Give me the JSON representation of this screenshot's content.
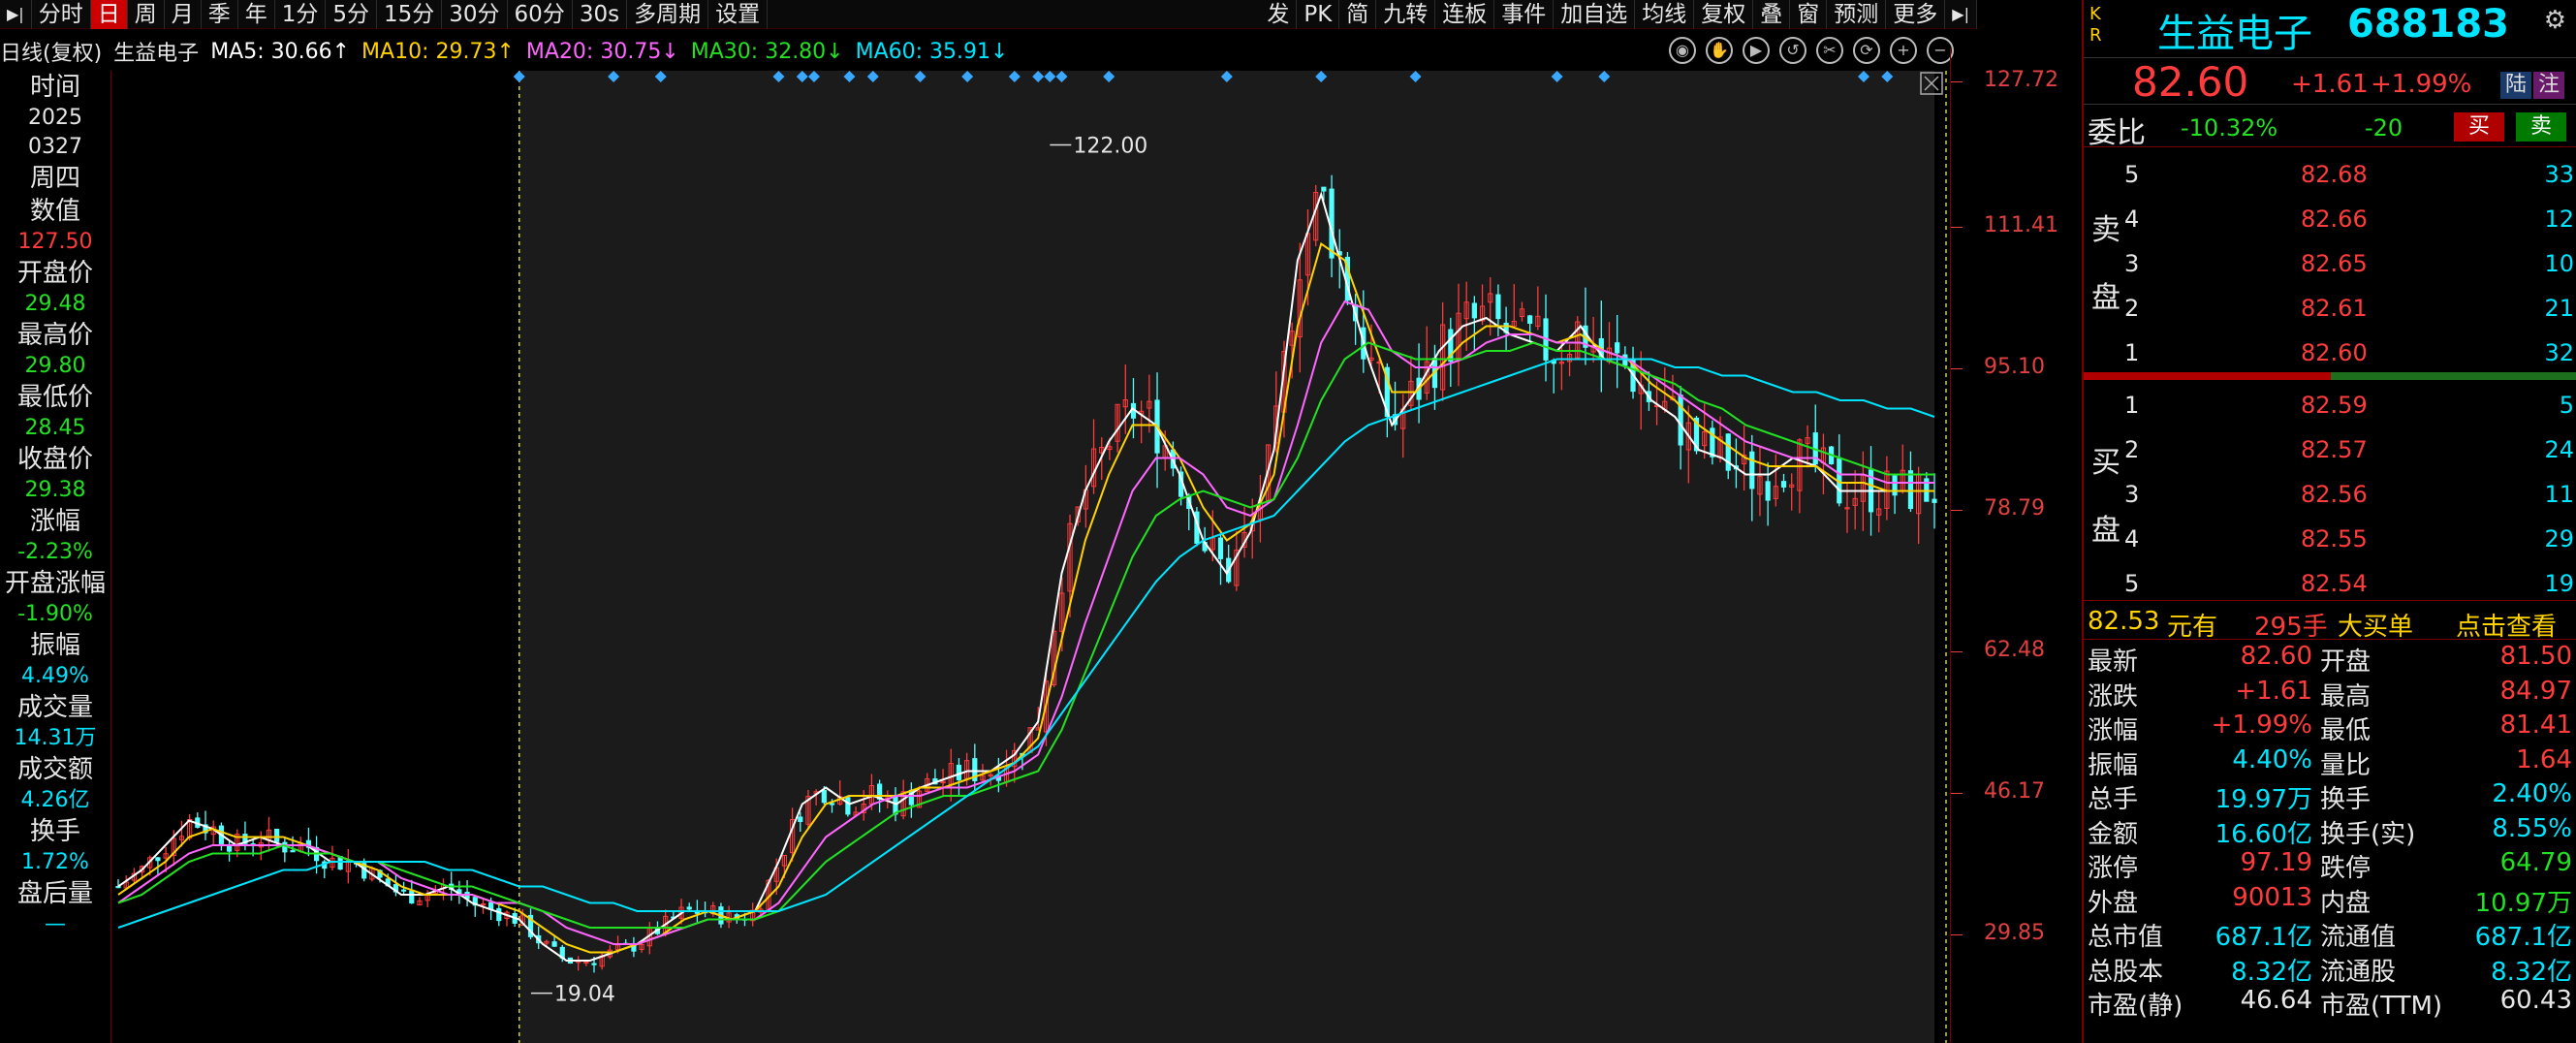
{
  "toolbar": {
    "left_items": [
      "分时",
      "日",
      "周",
      "月",
      "季",
      "年",
      "1分",
      "5分",
      "15分",
      "30分",
      "60分",
      "30s",
      "多周期",
      "设置"
    ],
    "active": "日",
    "right_items": [
      "发",
      "PK",
      "简",
      "九转",
      "连板",
      "事件",
      "加自选",
      "均线",
      "复权",
      "叠",
      "窗",
      "预测",
      "更多"
    ]
  },
  "ma_legend": {
    "prefix": "日线(复权)",
    "name": "生益电子",
    "ma5": "MA5: 30.66↑",
    "ma10": "MA10: 29.73↑",
    "ma20": "MA20: 30.75↓",
    "ma30": "MA30: 32.80↓",
    "ma60": "MA60: 35.91↓"
  },
  "colors": {
    "up": "#ff3b3b",
    "down": "#22e022",
    "ma5": "#ffffff",
    "ma10": "#ffd200",
    "ma20": "#ff66ff",
    "ma30": "#22e022",
    "ma60": "#00e5ff",
    "axis": "#e04040"
  },
  "left_panel": [
    {
      "label": "时间",
      "value": "2025",
      "color": "#e6e6e6"
    },
    {
      "label": "",
      "value": "0327",
      "color": "#e6e6e6"
    },
    {
      "label": "周四",
      "value": "",
      "color": "#e6e6e6"
    },
    {
      "label": "数值",
      "value": "127.50",
      "color": "#ff3b3b"
    },
    {
      "label": "开盘价",
      "value": "29.48",
      "color": "#22e022"
    },
    {
      "label": "最高价",
      "value": "29.80",
      "color": "#22e022"
    },
    {
      "label": "最低价",
      "value": "28.45",
      "color": "#22e022"
    },
    {
      "label": "收盘价",
      "value": "29.38",
      "color": "#22e022"
    },
    {
      "label": "涨幅",
      "value": "-2.23%",
      "color": "#22e022"
    },
    {
      "label": "开盘涨幅",
      "value": "-1.90%",
      "color": "#22e022"
    },
    {
      "label": "振幅",
      "value": "4.49%",
      "color": "#00e5ff"
    },
    {
      "label": "成交量",
      "value": "14.31万",
      "color": "#00e5ff"
    },
    {
      "label": "成交额",
      "value": "4.26亿",
      "color": "#00e5ff"
    },
    {
      "label": "换手",
      "value": "1.72%",
      "color": "#00e5ff"
    },
    {
      "label": "盘后量",
      "value": "—",
      "color": "#00e5ff"
    }
  ],
  "y_axis_ticks": [
    "127.72",
    "111.41",
    "95.10",
    "78.79",
    "62.48",
    "46.17",
    "29.85"
  ],
  "chart_data": {
    "type": "line",
    "ylim": [
      13.0,
      131.0
    ],
    "annotations": [
      {
        "text": "122.00"
      },
      {
        "text": "19.04"
      }
    ],
    "x": [
      0,
      4,
      8,
      12,
      16,
      20,
      24,
      28,
      32,
      36,
      40,
      44,
      48,
      52,
      56,
      60,
      64,
      68,
      72,
      76,
      80,
      84,
      88,
      92,
      96,
      100,
      104,
      108,
      112,
      116,
      120,
      124,
      128,
      132,
      136,
      140,
      144,
      148,
      152,
      156,
      160,
      164,
      168,
      172,
      176,
      180,
      184,
      188,
      192,
      196,
      200,
      204,
      208,
      212,
      216,
      220,
      224,
      228,
      232,
      236,
      240,
      244,
      248,
      252,
      256,
      260,
      264,
      268,
      272,
      276,
      280,
      284,
      288,
      292,
      296,
      300,
      304,
      308
    ],
    "series": [
      {
        "name": "MA5",
        "values": [
          32,
          34,
          37,
          40,
          39,
          37,
          38,
          37,
          37,
          35,
          35,
          33,
          31,
          31,
          32,
          30,
          29,
          28,
          25,
          23,
          23,
          24,
          25,
          27,
          29,
          29,
          28,
          29,
          35,
          42,
          44,
          42,
          43,
          42,
          44,
          45,
          46,
          46,
          48,
          52,
          70,
          80,
          86,
          90,
          88,
          82,
          74,
          70,
          75,
          85,
          108,
          116,
          106,
          96,
          88,
          92,
          97,
          100,
          101,
          99,
          98,
          97,
          100,
          96,
          95,
          91,
          89,
          85,
          84,
          82,
          82,
          84,
          83,
          80,
          80,
          80,
          80,
          80
        ]
      },
      {
        "name": "MA10",
        "values": [
          31,
          33,
          35,
          38,
          39,
          38,
          38,
          38,
          37,
          36,
          35,
          34,
          32,
          31,
          31,
          31,
          30,
          29,
          27,
          25,
          24,
          24,
          25,
          26,
          28,
          29,
          28,
          29,
          32,
          38,
          42,
          43,
          43,
          43,
          44,
          44,
          45,
          46,
          47,
          50,
          62,
          74,
          82,
          88,
          88,
          84,
          78,
          74,
          76,
          82,
          100,
          110,
          108,
          100,
          92,
          92,
          95,
          98,
          100,
          100,
          99,
          98,
          99,
          97,
          96,
          93,
          91,
          88,
          86,
          84,
          83,
          83,
          83,
          81,
          81,
          80,
          80,
          80
        ]
      },
      {
        "name": "MA20",
        "values": [
          30,
          32,
          34,
          36,
          37,
          37,
          37,
          37,
          37,
          36,
          35,
          35,
          33,
          32,
          31,
          31,
          30,
          30,
          29,
          27,
          26,
          25,
          25,
          26,
          27,
          28,
          28,
          28,
          30,
          34,
          38,
          40,
          42,
          43,
          43,
          44,
          44,
          45,
          46,
          48,
          55,
          64,
          72,
          80,
          84,
          84,
          82,
          78,
          77,
          79,
          88,
          98,
          103,
          102,
          97,
          95,
          95,
          96,
          98,
          99,
          99,
          98,
          98,
          97,
          96,
          94,
          92,
          90,
          88,
          86,
          85,
          84,
          84,
          82,
          82,
          81,
          81,
          81
        ]
      },
      {
        "name": "MA30",
        "values": [
          30,
          31,
          33,
          35,
          36,
          36,
          36,
          37,
          36,
          36,
          35,
          35,
          34,
          33,
          32,
          32,
          31,
          30,
          29,
          28,
          27,
          27,
          27,
          27,
          27,
          28,
          28,
          28,
          29,
          32,
          35,
          37,
          39,
          41,
          42,
          43,
          43,
          44,
          45,
          46,
          51,
          58,
          65,
          72,
          77,
          79,
          80,
          79,
          78,
          79,
          84,
          91,
          96,
          98,
          97,
          96,
          96,
          96,
          97,
          97,
          98,
          97,
          97,
          96,
          95,
          94,
          93,
          91,
          90,
          88,
          87,
          86,
          85,
          84,
          83,
          82,
          82,
          82
        ]
      },
      {
        "name": "MA60",
        "values": [
          27,
          28,
          29,
          30,
          31,
          32,
          33,
          34,
          34,
          35,
          35,
          35,
          35,
          35,
          34,
          34,
          33,
          32,
          32,
          31,
          30,
          30,
          29,
          29,
          29,
          29,
          29,
          29,
          29,
          30,
          31,
          33,
          35,
          37,
          39,
          41,
          43,
          45,
          47,
          49,
          53,
          57,
          61,
          65,
          69,
          72,
          74,
          75,
          76,
          77,
          80,
          83,
          86,
          88,
          89,
          90,
          91,
          92,
          93,
          94,
          95,
          96,
          96,
          96,
          96,
          96,
          95,
          95,
          94,
          94,
          93,
          92,
          92,
          91,
          91,
          90,
          90,
          89
        ]
      }
    ]
  },
  "right_panel": {
    "kr": [
      "K",
      "R"
    ],
    "name": "生益电子",
    "code": "688183",
    "price": "82.60",
    "change": "+1.61",
    "change_pct": "+1.99%",
    "badge1": "陆",
    "badge2": "注",
    "weibi_label": "委比",
    "weibi_pct": "-10.32%",
    "weibi_diff": "-20",
    "buy_btn": "买",
    "sell_btn": "卖",
    "sell_label": [
      "卖",
      "盘"
    ],
    "buy_label": [
      "买",
      "盘"
    ],
    "asks": [
      {
        "lvl": "5",
        "px": "82.68",
        "vol": "33"
      },
      {
        "lvl": "4",
        "px": "82.66",
        "vol": "12"
      },
      {
        "lvl": "3",
        "px": "82.65",
        "vol": "10"
      },
      {
        "lvl": "2",
        "px": "82.61",
        "vol": "21"
      },
      {
        "lvl": "1",
        "px": "82.60",
        "vol": "32"
      }
    ],
    "bids": [
      {
        "lvl": "1",
        "px": "82.59",
        "vol": "5"
      },
      {
        "lvl": "2",
        "px": "82.57",
        "vol": "24"
      },
      {
        "lvl": "3",
        "px": "82.56",
        "vol": "11"
      },
      {
        "lvl": "4",
        "px": "82.55",
        "vol": "29"
      },
      {
        "lvl": "5",
        "px": "82.54",
        "vol": "19"
      }
    ],
    "bigbuy": {
      "price": "82.53",
      "text1": "元有",
      "hands": "295手",
      "text2": "大买单",
      "link": "点击查看"
    },
    "stats": [
      {
        "k1": "最新",
        "v1": "82.60",
        "c1": "red",
        "k2": "开盘",
        "v2": "81.50",
        "c2": "red"
      },
      {
        "k1": "涨跌",
        "v1": "+1.61",
        "c1": "red",
        "k2": "最高",
        "v2": "84.97",
        "c2": "red"
      },
      {
        "k1": "涨幅",
        "v1": "+1.99%",
        "c1": "red",
        "k2": "最低",
        "v2": "81.41",
        "c2": "red"
      },
      {
        "k1": "振幅",
        "v1": "4.40%",
        "c1": "cyan",
        "k2": "量比",
        "v2": "1.64",
        "c2": "red"
      },
      {
        "k1": "总手",
        "v1": "19.97万",
        "c1": "cyan",
        "k2": "换手",
        "v2": "2.40%",
        "c2": "cyan"
      },
      {
        "k1": "金额",
        "v1": "16.60亿",
        "c1": "cyan",
        "k2": "换手(实)",
        "v2": "8.55%",
        "c2": "cyan"
      },
      {
        "k1": "涨停",
        "v1": "97.19",
        "c1": "red",
        "k2": "跌停",
        "v2": "64.79",
        "c2": "green"
      },
      {
        "k1": "外盘",
        "v1": "90013",
        "c1": "red",
        "k2": "内盘",
        "v2": "10.97万",
        "c2": "green"
      },
      {
        "k1": "总市值",
        "v1": "687.1亿",
        "c1": "cyan",
        "k2": "流通值",
        "v2": "687.1亿",
        "c2": "cyan"
      },
      {
        "k1": "总股本",
        "v1": "8.32亿",
        "c1": "cyan",
        "k2": "流通股",
        "v2": "8.32亿",
        "c2": "cyan"
      },
      {
        "k1": "市盈(静)",
        "v1": "46.64",
        "c1": "white",
        "k2": "市盈(TTM)",
        "v2": "60.43",
        "c2": "white"
      }
    ]
  }
}
